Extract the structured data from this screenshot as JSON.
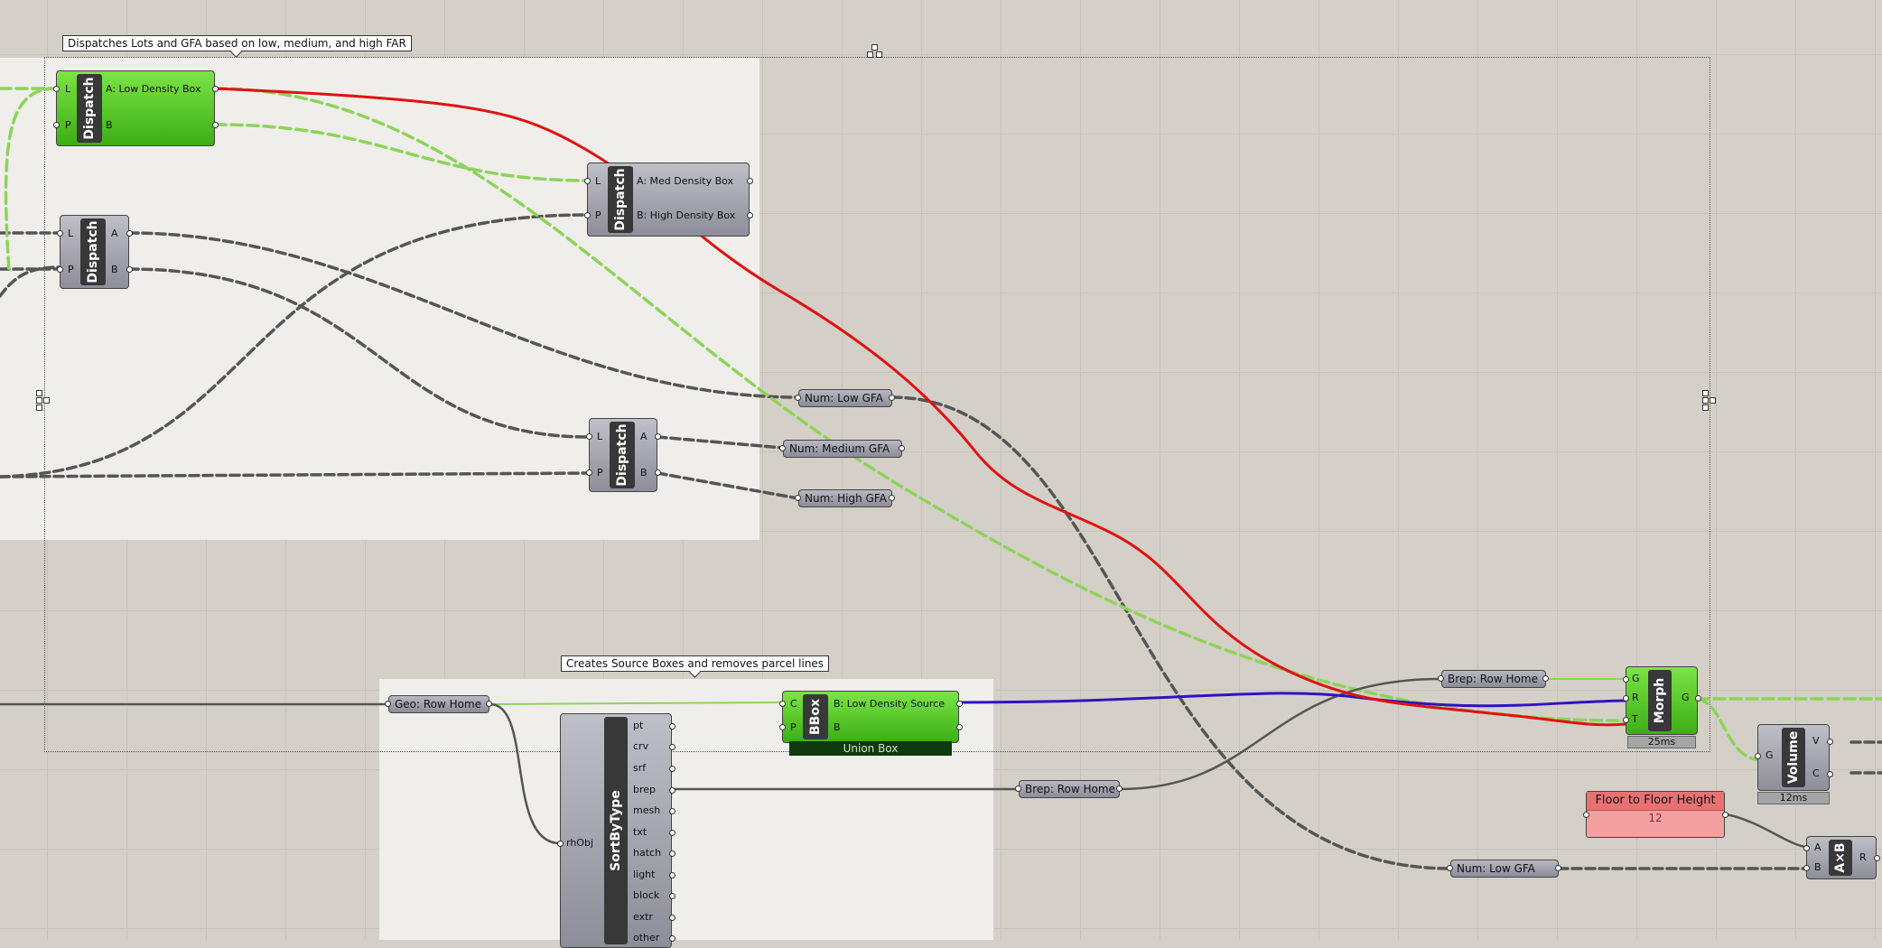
{
  "groups": {
    "dispatch_label": "Dispatches Lots and GFA based on low, medium, and high FAR",
    "source_label": "Creates Source Boxes and removes parcel lines"
  },
  "dispatch1": {
    "title": "Dispatch",
    "in": [
      "L",
      "P"
    ],
    "out": [
      "A: Low Density Box",
      "B"
    ]
  },
  "dispatch2": {
    "title": "Dispatch",
    "in": [
      "L",
      "P"
    ],
    "out": [
      "A: Med Density Box",
      "B: High Density Box"
    ]
  },
  "dispatch3": {
    "title": "Dispatch",
    "in": [
      "L",
      "P"
    ],
    "out": [
      "A",
      "B"
    ]
  },
  "dispatch4": {
    "title": "Dispatch",
    "in": [
      "L",
      "P"
    ],
    "out": [
      "A",
      "B"
    ]
  },
  "params": {
    "num_low_gfa": "Num: Low GFA",
    "num_medium_gfa": "Num:  Medium GFA",
    "num_high_gfa": "Num: High GFA",
    "geo_row_home": "Geo: Row Home",
    "brep_row_home_1": "Brep: Row Home",
    "brep_row_home_2": "Brep: Row Home",
    "num_low_gfa_2": "Num: Low GFA"
  },
  "bbox": {
    "title": "BBox",
    "in": [
      "C",
      "P"
    ],
    "out": [
      "B: Low Density Source",
      "B"
    ],
    "union": "Union Box"
  },
  "sortbytype": {
    "title": "SortByType",
    "in": [
      "rhObj"
    ],
    "out": [
      "pt",
      "crv",
      "srf",
      "brep",
      "mesh",
      "txt",
      "hatch",
      "light",
      "block",
      "extr",
      "other"
    ]
  },
  "morph": {
    "title": "Morph",
    "in": [
      "G",
      "R",
      "T"
    ],
    "out": [
      "G"
    ],
    "timing": "25ms"
  },
  "volume": {
    "title": "Volume",
    "in": [
      "G"
    ],
    "out": [
      "V",
      "C"
    ],
    "timing": "12ms"
  },
  "multiply": {
    "title": "A×B",
    "in": [
      "A",
      "B"
    ],
    "out": [
      "R"
    ]
  },
  "slider": {
    "label": "Floor to Floor Height",
    "value": "12"
  },
  "colors": {
    "canvas": "#d4d0c8",
    "green": "#5ccc2c",
    "red": "#e01010",
    "blue": "#3010c0",
    "wire": "#555555"
  }
}
